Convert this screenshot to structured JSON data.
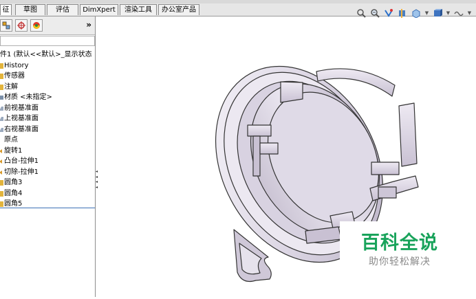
{
  "tabs": [
    "征",
    "草图",
    "评估",
    "DimXpert",
    "渲染工具",
    "办公室产品"
  ],
  "panel": {
    "expand_glyph": "»",
    "tree": [
      {
        "label": "件1 (默认<<默认>_显示状态",
        "icon": "part-icon"
      },
      {
        "label": "History",
        "icon": "history-icon"
      },
      {
        "label": "传感器",
        "icon": "sensor-icon"
      },
      {
        "label": "注解",
        "icon": "annotation-icon"
      },
      {
        "label": "材质 <未指定>",
        "icon": "material-icon"
      },
      {
        "label": "前视基准面",
        "icon": "plane-icon"
      },
      {
        "label": "上视基准面",
        "icon": "plane-icon"
      },
      {
        "label": "右视基准面",
        "icon": "plane-icon"
      },
      {
        "label": "原点",
        "icon": "origin-icon"
      },
      {
        "label": "旋转1",
        "icon": "revolve-icon"
      },
      {
        "label": "凸台-拉伸1",
        "icon": "extrude-icon"
      },
      {
        "label": "切除-拉伸1",
        "icon": "cut-icon"
      },
      {
        "label": "圆角3",
        "icon": "fillet-icon"
      },
      {
        "label": "圆角4",
        "icon": "fillet-icon"
      },
      {
        "label": "圆角5",
        "icon": "fillet-icon"
      }
    ]
  },
  "watermark": {
    "title": "百科全说",
    "subtitle": "助你轻松解决"
  },
  "colors": {
    "accent": "#19a35b",
    "selection_line": "#3b6fb5"
  }
}
